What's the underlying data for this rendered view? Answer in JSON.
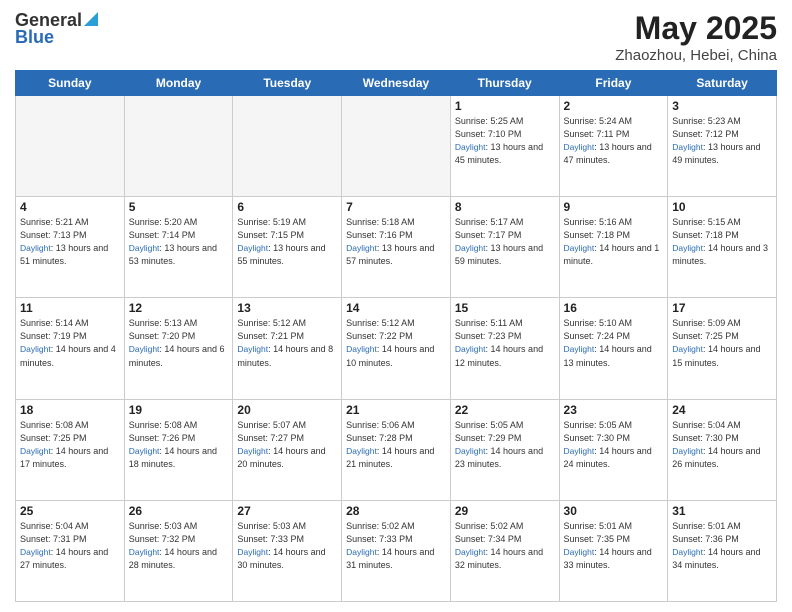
{
  "header": {
    "logo_general": "General",
    "logo_blue": "Blue",
    "month": "May 2025",
    "location": "Zhaozhou, Hebei, China"
  },
  "days_of_week": [
    "Sunday",
    "Monday",
    "Tuesday",
    "Wednesday",
    "Thursday",
    "Friday",
    "Saturday"
  ],
  "weeks": [
    [
      {
        "day": "",
        "sunrise": "",
        "sunset": "",
        "daylight": ""
      },
      {
        "day": "",
        "sunrise": "",
        "sunset": "",
        "daylight": ""
      },
      {
        "day": "",
        "sunrise": "",
        "sunset": "",
        "daylight": ""
      },
      {
        "day": "",
        "sunrise": "",
        "sunset": "",
        "daylight": ""
      },
      {
        "day": "1",
        "sunrise": "Sunrise: 5:25 AM",
        "sunset": "Sunset: 7:10 PM",
        "daylight": "Daylight: 13 hours and 45 minutes."
      },
      {
        "day": "2",
        "sunrise": "Sunrise: 5:24 AM",
        "sunset": "Sunset: 7:11 PM",
        "daylight": "Daylight: 13 hours and 47 minutes."
      },
      {
        "day": "3",
        "sunrise": "Sunrise: 5:23 AM",
        "sunset": "Sunset: 7:12 PM",
        "daylight": "Daylight: 13 hours and 49 minutes."
      }
    ],
    [
      {
        "day": "4",
        "sunrise": "Sunrise: 5:21 AM",
        "sunset": "Sunset: 7:13 PM",
        "daylight": "Daylight: 13 hours and 51 minutes."
      },
      {
        "day": "5",
        "sunrise": "Sunrise: 5:20 AM",
        "sunset": "Sunset: 7:14 PM",
        "daylight": "Daylight: 13 hours and 53 minutes."
      },
      {
        "day": "6",
        "sunrise": "Sunrise: 5:19 AM",
        "sunset": "Sunset: 7:15 PM",
        "daylight": "Daylight: 13 hours and 55 minutes."
      },
      {
        "day": "7",
        "sunrise": "Sunrise: 5:18 AM",
        "sunset": "Sunset: 7:16 PM",
        "daylight": "Daylight: 13 hours and 57 minutes."
      },
      {
        "day": "8",
        "sunrise": "Sunrise: 5:17 AM",
        "sunset": "Sunset: 7:17 PM",
        "daylight": "Daylight: 13 hours and 59 minutes."
      },
      {
        "day": "9",
        "sunrise": "Sunrise: 5:16 AM",
        "sunset": "Sunset: 7:18 PM",
        "daylight": "Daylight: 14 hours and 1 minute."
      },
      {
        "day": "10",
        "sunrise": "Sunrise: 5:15 AM",
        "sunset": "Sunset: 7:18 PM",
        "daylight": "Daylight: 14 hours and 3 minutes."
      }
    ],
    [
      {
        "day": "11",
        "sunrise": "Sunrise: 5:14 AM",
        "sunset": "Sunset: 7:19 PM",
        "daylight": "Daylight: 14 hours and 4 minutes."
      },
      {
        "day": "12",
        "sunrise": "Sunrise: 5:13 AM",
        "sunset": "Sunset: 7:20 PM",
        "daylight": "Daylight: 14 hours and 6 minutes."
      },
      {
        "day": "13",
        "sunrise": "Sunrise: 5:12 AM",
        "sunset": "Sunset: 7:21 PM",
        "daylight": "Daylight: 14 hours and 8 minutes."
      },
      {
        "day": "14",
        "sunrise": "Sunrise: 5:12 AM",
        "sunset": "Sunset: 7:22 PM",
        "daylight": "Daylight: 14 hours and 10 minutes."
      },
      {
        "day": "15",
        "sunrise": "Sunrise: 5:11 AM",
        "sunset": "Sunset: 7:23 PM",
        "daylight": "Daylight: 14 hours and 12 minutes."
      },
      {
        "day": "16",
        "sunrise": "Sunrise: 5:10 AM",
        "sunset": "Sunset: 7:24 PM",
        "daylight": "Daylight: 14 hours and 13 minutes."
      },
      {
        "day": "17",
        "sunrise": "Sunrise: 5:09 AM",
        "sunset": "Sunset: 7:25 PM",
        "daylight": "Daylight: 14 hours and 15 minutes."
      }
    ],
    [
      {
        "day": "18",
        "sunrise": "Sunrise: 5:08 AM",
        "sunset": "Sunset: 7:25 PM",
        "daylight": "Daylight: 14 hours and 17 minutes."
      },
      {
        "day": "19",
        "sunrise": "Sunrise: 5:08 AM",
        "sunset": "Sunset: 7:26 PM",
        "daylight": "Daylight: 14 hours and 18 minutes."
      },
      {
        "day": "20",
        "sunrise": "Sunrise: 5:07 AM",
        "sunset": "Sunset: 7:27 PM",
        "daylight": "Daylight: 14 hours and 20 minutes."
      },
      {
        "day": "21",
        "sunrise": "Sunrise: 5:06 AM",
        "sunset": "Sunset: 7:28 PM",
        "daylight": "Daylight: 14 hours and 21 minutes."
      },
      {
        "day": "22",
        "sunrise": "Sunrise: 5:05 AM",
        "sunset": "Sunset: 7:29 PM",
        "daylight": "Daylight: 14 hours and 23 minutes."
      },
      {
        "day": "23",
        "sunrise": "Sunrise: 5:05 AM",
        "sunset": "Sunset: 7:30 PM",
        "daylight": "Daylight: 14 hours and 24 minutes."
      },
      {
        "day": "24",
        "sunrise": "Sunrise: 5:04 AM",
        "sunset": "Sunset: 7:30 PM",
        "daylight": "Daylight: 14 hours and 26 minutes."
      }
    ],
    [
      {
        "day": "25",
        "sunrise": "Sunrise: 5:04 AM",
        "sunset": "Sunset: 7:31 PM",
        "daylight": "Daylight: 14 hours and 27 minutes."
      },
      {
        "day": "26",
        "sunrise": "Sunrise: 5:03 AM",
        "sunset": "Sunset: 7:32 PM",
        "daylight": "Daylight: 14 hours and 28 minutes."
      },
      {
        "day": "27",
        "sunrise": "Sunrise: 5:03 AM",
        "sunset": "Sunset: 7:33 PM",
        "daylight": "Daylight: 14 hours and 30 minutes."
      },
      {
        "day": "28",
        "sunrise": "Sunrise: 5:02 AM",
        "sunset": "Sunset: 7:33 PM",
        "daylight": "Daylight: 14 hours and 31 minutes."
      },
      {
        "day": "29",
        "sunrise": "Sunrise: 5:02 AM",
        "sunset": "Sunset: 7:34 PM",
        "daylight": "Daylight: 14 hours and 32 minutes."
      },
      {
        "day": "30",
        "sunrise": "Sunrise: 5:01 AM",
        "sunset": "Sunset: 7:35 PM",
        "daylight": "Daylight: 14 hours and 33 minutes."
      },
      {
        "day": "31",
        "sunrise": "Sunrise: 5:01 AM",
        "sunset": "Sunset: 7:36 PM",
        "daylight": "Daylight: 14 hours and 34 minutes."
      }
    ]
  ]
}
